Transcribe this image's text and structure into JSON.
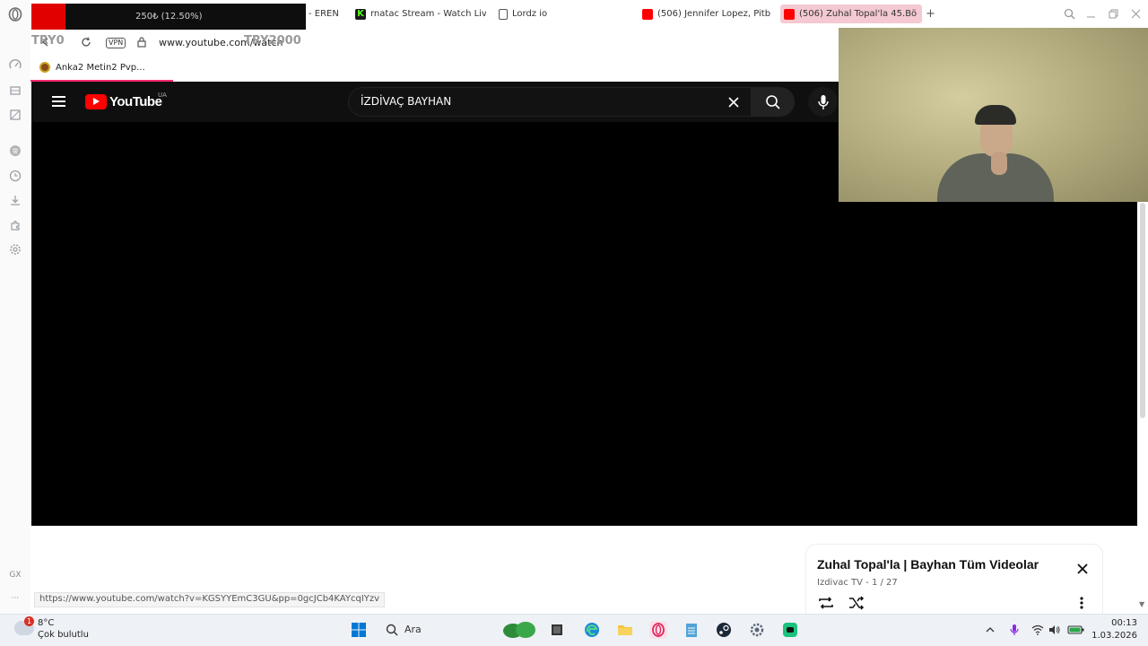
{
  "browser": {
    "tabs": [
      {
        "label": "- EREN",
        "favicon_color": "#1a1a1a"
      },
      {
        "label": "rnatac Stream - Watch Liv",
        "favicon_color": "#53fc18"
      },
      {
        "label": "Lordz io",
        "favicon_color": "#ffffff"
      },
      {
        "label": "(506) Jennifer Lopez, Pitb",
        "favicon_color": "#ff0000"
      },
      {
        "label": "(506) Zuhal Topal'la 45.Bö",
        "favicon_color": "#ff0000"
      }
    ],
    "new_tab_symbol": "+",
    "address": {
      "vpn_label": "VPN",
      "url": "www.youtube.com/watch"
    },
    "bookmarks": [
      {
        "label": "Anka2 Metin2 Pvp..."
      }
    ],
    "sidebar_gx_label": "GX",
    "sidebar_more": "···"
  },
  "overlay": {
    "progress_text": "250₺ (12.50%)",
    "left_label": "TRY0",
    "right_label": "TRY2000",
    "progress_fraction": 0.125
  },
  "youtube": {
    "logo_text": "YouTube",
    "country_code": "UA",
    "search_query": "İZDİVAÇ BAYHAN",
    "colors": {
      "brand_red": "#ff0000",
      "header_bg": "#0f0f0f"
    }
  },
  "playlist": {
    "title": "Zuhal Topal'la | Bayhan Tüm Videolar",
    "subtitle": "Izdivac TV - 1 / 27"
  },
  "status_bar": {
    "hover_url": "https://www.youtube.com/watch?v=KGSYYEmC3GU&pp=0gcJCb4KAYcqIYzv"
  },
  "taskbar": {
    "weather_badge": "1",
    "weather_temp": "8°C",
    "weather_desc": "Çok bulutlu",
    "search_label": "Ara",
    "time": "00:13",
    "date": "1.03.2026"
  }
}
